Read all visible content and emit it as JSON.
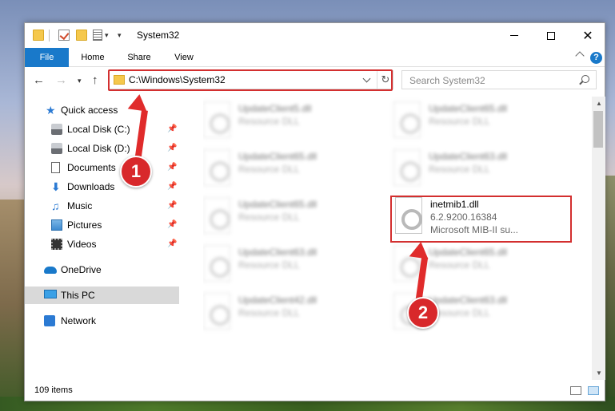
{
  "window": {
    "title": "System32"
  },
  "ribbon": {
    "tabs": [
      "File",
      "Home",
      "Share",
      "View"
    ],
    "help_icon": "?"
  },
  "address": {
    "path": "C:\\Windows\\System32",
    "refresh_glyph": "↻"
  },
  "search": {
    "placeholder": "Search System32"
  },
  "sidebar": {
    "items": [
      {
        "label": "Quick access",
        "icon": "star-icon"
      },
      {
        "label": "Local Disk (C:)",
        "icon": "disk-icon",
        "pinned": true
      },
      {
        "label": "Local Disk (D:)",
        "icon": "disk-icon",
        "pinned": true
      },
      {
        "label": "Documents",
        "icon": "documents-icon",
        "pinned": true
      },
      {
        "label": "Downloads",
        "icon": "downloads-icon",
        "pinned": true
      },
      {
        "label": "Music",
        "icon": "music-icon",
        "pinned": true
      },
      {
        "label": "Pictures",
        "icon": "pictures-icon",
        "pinned": true
      },
      {
        "label": "Videos",
        "icon": "videos-icon",
        "pinned": true
      },
      {
        "label": "OneDrive",
        "icon": "onedrive-icon"
      },
      {
        "label": "This PC",
        "icon": "pc-icon",
        "selected": true
      },
      {
        "label": "Network",
        "icon": "network-icon"
      }
    ]
  },
  "files": [
    {
      "name": "UpdateClient5.dll",
      "type": "Resource DLL"
    },
    {
      "name": "UpdateClient65.dll",
      "type": "Resource DLL"
    },
    {
      "name": "UpdateClient65.dll",
      "type": "Resource DLL"
    },
    {
      "name": "UpdateClient63.dll",
      "type": "Resource DLL"
    },
    {
      "name": "UpdateClient65.dll",
      "type": "Resource DLL"
    },
    {
      "name": "inetmib1.dll",
      "version": "6.2.9200.16384",
      "desc": "Microsoft MIB-II su..."
    },
    {
      "name": "UpdateClient63.dll",
      "type": "Resource DLL"
    },
    {
      "name": "UpdateClient65.dll",
      "type": "Resource DLL"
    },
    {
      "name": "UpdateClient42.dll",
      "type": "Resource DLL"
    },
    {
      "name": "UpdateClient63.dll",
      "type": "Resource DLL"
    }
  ],
  "status": {
    "item_count": "109 items"
  },
  "annotations": {
    "step1": "1",
    "step2": "2"
  },
  "colors": {
    "accent": "#1979ca",
    "highlight": "#d32f2f",
    "annotation": "#e02b2b"
  }
}
